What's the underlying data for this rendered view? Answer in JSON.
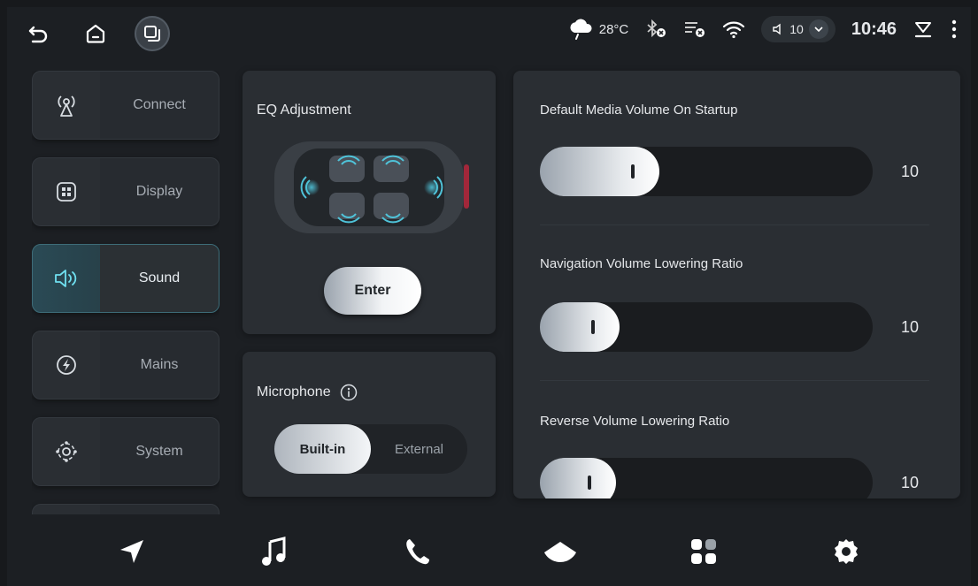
{
  "status": {
    "weather": "28°C",
    "volume": "10",
    "time": "10:46"
  },
  "sidebar": {
    "items": [
      {
        "label": "Connect",
        "icon": "antenna-icon"
      },
      {
        "label": "Display",
        "icon": "display-grid-icon"
      },
      {
        "label": "Sound",
        "icon": "speaker-icon",
        "active": true
      },
      {
        "label": "Mains",
        "icon": "bolt-icon"
      },
      {
        "label": "System",
        "icon": "system-settings-icon"
      }
    ]
  },
  "eq": {
    "title": "EQ Adjustment",
    "button": "Enter"
  },
  "microphone": {
    "title": "Microphone",
    "options": [
      "Built-in",
      "External"
    ],
    "selected": "Built-in"
  },
  "volumes": [
    {
      "label": "Default Media Volume On Startup",
      "value": "10",
      "fraction": 0.36
    },
    {
      "label": "Navigation Volume Lowering Ratio",
      "value": "10",
      "fraction": 0.24
    },
    {
      "label": "Reverse Volume Lowering Ratio",
      "value": "10",
      "fraction": 0.23
    }
  ],
  "colors": {
    "accent": "#4fc3d9",
    "background": "#1c1f23",
    "card": "#2a2e33"
  }
}
